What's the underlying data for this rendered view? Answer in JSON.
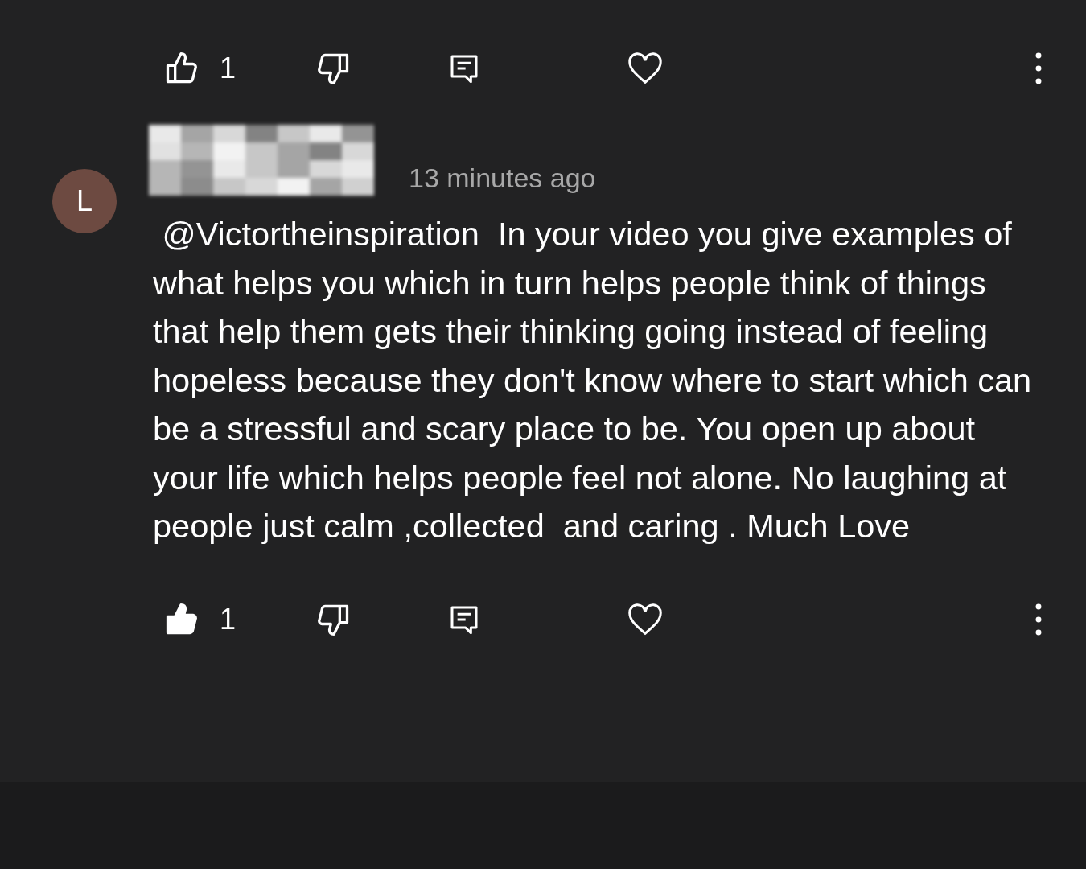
{
  "comments": [
    {
      "kind": "tail",
      "liked": false,
      "like_count": "1"
    },
    {
      "kind": "full",
      "avatar_letter": "L",
      "time": "13 minutes ago",
      "text": " @Victortheinspiration  In your video you give examples of what helps you which in turn helps people think of things that help them gets their thinking going instead of feeling hopeless because they don't know where to start which can be a stressful and scary place to be. You open up about your life which helps people feel not alone. No laughing at people just calm ,collected  and caring . Much Love",
      "liked": true,
      "like_count": "1"
    }
  ]
}
